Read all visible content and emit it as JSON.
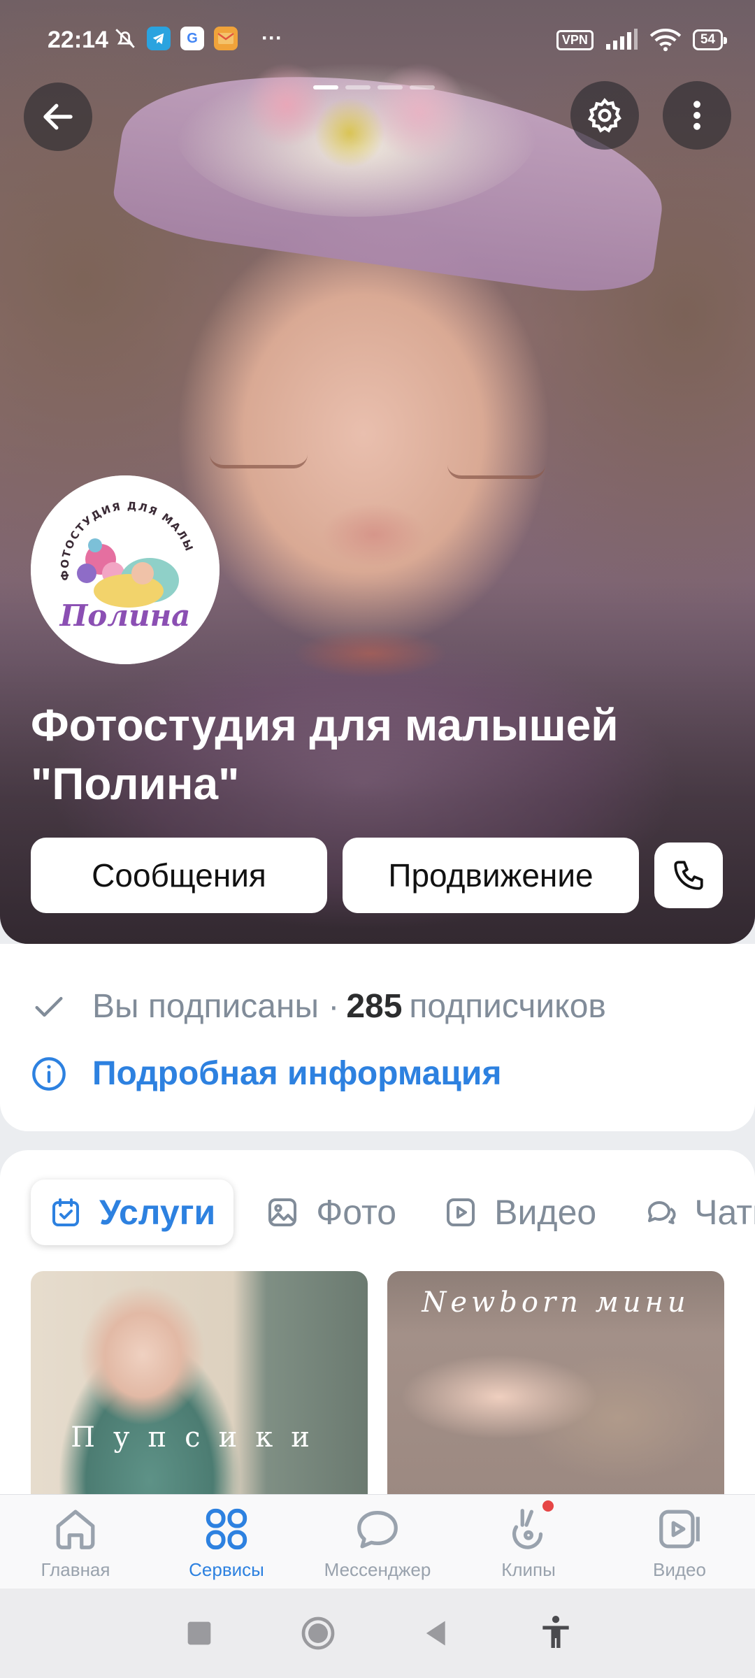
{
  "status_bar": {
    "time": "22:14",
    "vpn_label": "VPN",
    "battery": "54",
    "more": "···"
  },
  "header": {
    "back_icon": "arrow-left-icon",
    "settings_icon": "gear-icon",
    "more_icon": "more-vertical-icon"
  },
  "community": {
    "logo_text_top": "ФОТОСТУДИЯ ДЛЯ МАЛЫШЕЙ",
    "logo_text_name": "Полина",
    "name": "Фотостудия для малышей \"Полина\""
  },
  "actions": {
    "messages_label": "Сообщения",
    "promote_label": "Продвижение"
  },
  "info": {
    "subscribed_label": "Вы подписаны ·",
    "subscribers_count": "285",
    "subscribers_label": "подписчиков",
    "details_label": "Подробная информация"
  },
  "tabs": [
    {
      "label": "Услуги",
      "icon": "calendar-check-icon",
      "active": true
    },
    {
      "label": "Фото",
      "icon": "image-icon",
      "active": false
    },
    {
      "label": "Видео",
      "icon": "video-icon",
      "active": false
    },
    {
      "label": "Чаты",
      "icon": "chat-icon",
      "active": false
    }
  ],
  "services": [
    {
      "title": "Пупсики"
    },
    {
      "title": "Newborn мини"
    }
  ],
  "bottom_nav": [
    {
      "label": "Главная",
      "icon": "home-icon",
      "active": false
    },
    {
      "label": "Сервисы",
      "icon": "services-grid-icon",
      "active": true
    },
    {
      "label": "Мессенджер",
      "icon": "message-bubble-icon",
      "active": false
    },
    {
      "label": "Клипы",
      "icon": "clips-icon",
      "active": false,
      "badge": true
    },
    {
      "label": "Видео",
      "icon": "video-play-icon",
      "active": false
    }
  ],
  "colors": {
    "accent": "#2d81e0",
    "secondary_text": "#818c99",
    "badge": "#e64646"
  }
}
